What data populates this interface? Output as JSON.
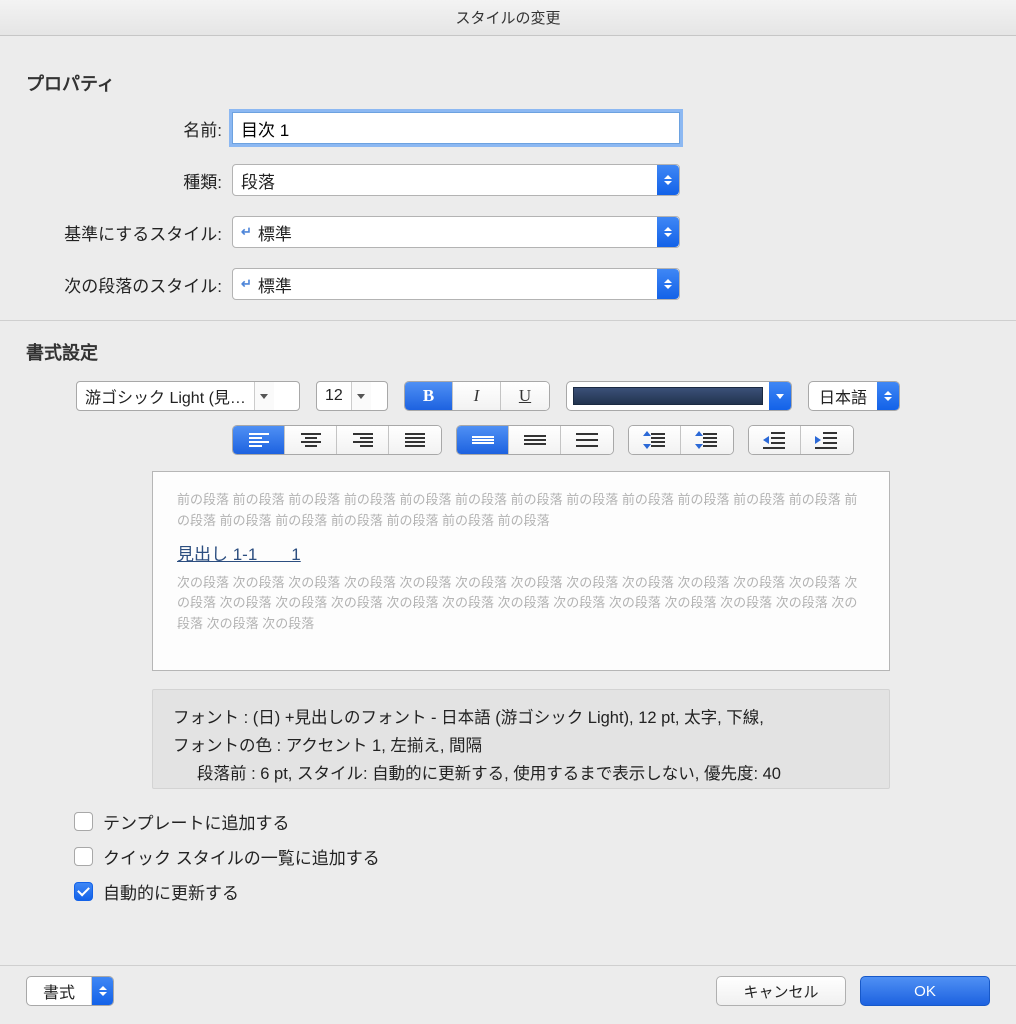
{
  "window": {
    "title": "スタイルの変更"
  },
  "properties": {
    "section_title": "プロパティ",
    "name_label": "名前:",
    "name_value": "目次 1",
    "type_label": "種類:",
    "type_value": "段落",
    "based_on_label": "基準にするスタイル:",
    "based_on_value": "標準",
    "next_style_label": "次の段落のスタイル:",
    "next_style_value": "標準"
  },
  "formatting": {
    "section_title": "書式設定",
    "font_name": "游ゴシック Light (見…",
    "font_size": "12",
    "bold_label": "B",
    "italic_label": "I",
    "underline_label": "U",
    "color_value": "#2e4463",
    "language": "日本語"
  },
  "preview": {
    "prev_repeat": "前の段落 前の段落 前の段落 前の段落 前の段落 前の段落 前の段落 前の段落 前の段落 前の段落 前の段落 前の段落 前の段落 前の段落 前の段落 前の段落 前の段落 前の段落 前の段落",
    "heading": "見出し 1-1　　1",
    "next_repeat": "次の段落 次の段落 次の段落 次の段落 次の段落 次の段落 次の段落 次の段落 次の段落 次の段落 次の段落 次の段落 次の段落 次の段落 次の段落 次の段落 次の段落 次の段落 次の段落 次の段落 次の段落 次の段落 次の段落 次の段落 次の段落 次の段落 次の段落"
  },
  "description": {
    "line1": "フォント : (日) +見出しのフォント - 日本語 (游ゴシック Light), 12 pt, 太字, 下線,",
    "line2": "フォントの色 : アクセント 1, 左揃え, 間隔",
    "line3": "段落前 :  6 pt, スタイル: 自動的に更新する, 使用するまで表示しない, 優先度: 40"
  },
  "checkboxes": {
    "add_template": "テンプレートに追加する",
    "add_quick": "クイック スタイルの一覧に追加する",
    "auto_update": "自動的に更新する"
  },
  "footer": {
    "format_label": "書式",
    "cancel": "キャンセル",
    "ok": "OK"
  }
}
